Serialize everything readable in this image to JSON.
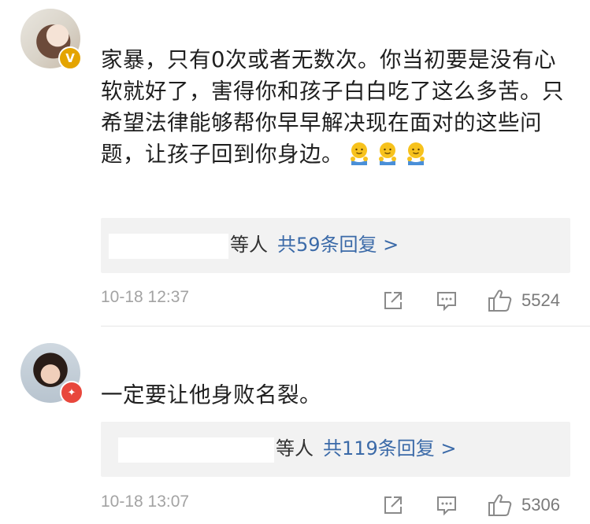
{
  "comments": [
    {
      "badge": "V",
      "text": "家暴，只有0次或者无数次。你当初要是没有心软就好了，害得你和孩子白白吃了这么多苦。只希望法律能够帮你早早解决现在面对的这些问题，让孩子回到你身边。",
      "emoji": "hug-emoji",
      "replies": {
        "others_label": "等人",
        "count_label": "共59条回复 >"
      },
      "timestamp": "10-18 12:37",
      "likes": "5524"
    },
    {
      "badge": "✦",
      "text": "一定要让他身败名裂。",
      "replies": {
        "others_label": "等人",
        "count_label": "共119条回复 >"
      },
      "timestamp": "10-18 13:07",
      "likes": "5306"
    }
  ],
  "colors": {
    "link": "#3b6aa8",
    "meta": "#a3a3a3",
    "reply_box": "#f2f2f2",
    "badge_gold": "#e4a400",
    "badge_red": "#e8473c"
  }
}
